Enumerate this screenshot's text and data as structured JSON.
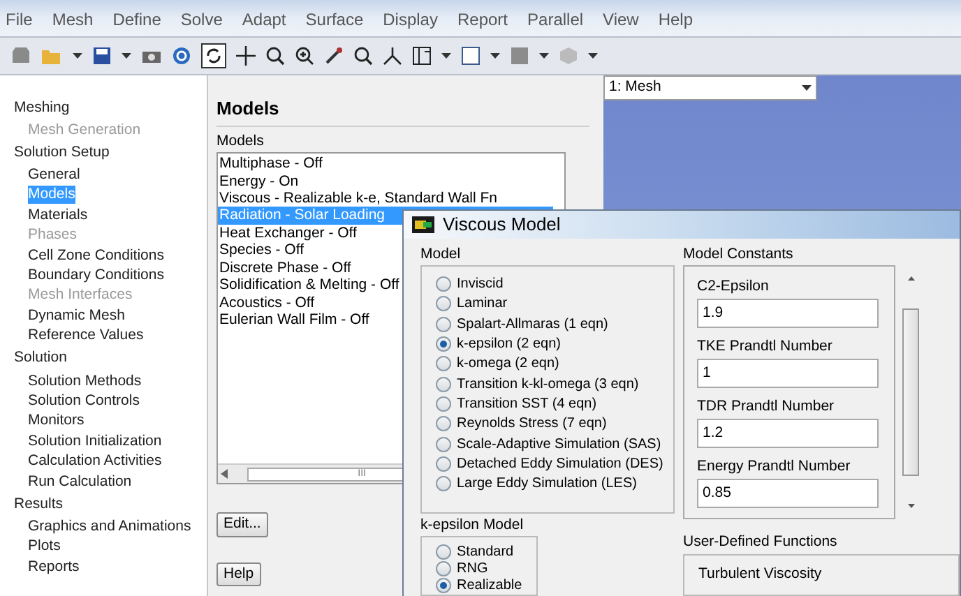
{
  "menu": [
    "File",
    "Mesh",
    "Define",
    "Solve",
    "Adapt",
    "Surface",
    "Display",
    "Report",
    "Parallel",
    "View",
    "Help"
  ],
  "sidebar": [
    {
      "label": "Meshing",
      "kind": "header",
      "selected": false,
      "disabled": false
    },
    {
      "label": "Mesh Generation",
      "kind": "item",
      "selected": false,
      "disabled": true
    },
    {
      "label": "Solution Setup",
      "kind": "header",
      "selected": false,
      "disabled": false
    },
    {
      "label": "General",
      "kind": "item",
      "selected": false,
      "disabled": false
    },
    {
      "label": "Models",
      "kind": "item",
      "selected": true,
      "disabled": false
    },
    {
      "label": "Materials",
      "kind": "item",
      "selected": false,
      "disabled": false
    },
    {
      "label": "Phases",
      "kind": "item",
      "selected": false,
      "disabled": true
    },
    {
      "label": "Cell Zone Conditions",
      "kind": "item",
      "selected": false,
      "disabled": false
    },
    {
      "label": "Boundary Conditions",
      "kind": "item",
      "selected": false,
      "disabled": false
    },
    {
      "label": "Mesh Interfaces",
      "kind": "item",
      "selected": false,
      "disabled": true
    },
    {
      "label": "Dynamic Mesh",
      "kind": "item",
      "selected": false,
      "disabled": false
    },
    {
      "label": "Reference Values",
      "kind": "item",
      "selected": false,
      "disabled": false
    },
    {
      "label": "Solution",
      "kind": "header",
      "selected": false,
      "disabled": false
    },
    {
      "label": "Solution Methods",
      "kind": "item",
      "selected": false,
      "disabled": false
    },
    {
      "label": "Solution Controls",
      "kind": "item",
      "selected": false,
      "disabled": false
    },
    {
      "label": "Monitors",
      "kind": "item",
      "selected": false,
      "disabled": false
    },
    {
      "label": "Solution Initialization",
      "kind": "item",
      "selected": false,
      "disabled": false
    },
    {
      "label": "Calculation Activities",
      "kind": "item",
      "selected": false,
      "disabled": false
    },
    {
      "label": "Run Calculation",
      "kind": "item",
      "selected": false,
      "disabled": false
    },
    {
      "label": "Results",
      "kind": "header",
      "selected": false,
      "disabled": false
    },
    {
      "label": "Graphics and Animations",
      "kind": "item",
      "selected": false,
      "disabled": false
    },
    {
      "label": "Plots",
      "kind": "item",
      "selected": false,
      "disabled": false
    },
    {
      "label": "Reports",
      "kind": "item",
      "selected": false,
      "disabled": false
    }
  ],
  "models_panel": {
    "title": "Models",
    "list_label": "Models",
    "models": [
      {
        "label": "Multiphase - Off",
        "selected": false
      },
      {
        "label": "Energy - On",
        "selected": false
      },
      {
        "label": "Viscous - Realizable k-e, Standard Wall Fn",
        "selected": false
      },
      {
        "label": "Radiation - Solar Loading",
        "selected": true
      },
      {
        "label": "Heat Exchanger - Off",
        "selected": false
      },
      {
        "label": "Species - Off",
        "selected": false
      },
      {
        "label": "Discrete Phase - Off",
        "selected": false
      },
      {
        "label": "Solidification & Melting - Off",
        "selected": false
      },
      {
        "label": "Acoustics - Off",
        "selected": false
      },
      {
        "label": "Eulerian Wall Film - Off",
        "selected": false
      }
    ],
    "scroll_mark": "III",
    "edit_button": "Edit...",
    "help_button": "Help"
  },
  "graphics": {
    "window_select": "1: Mesh"
  },
  "dialog": {
    "title": "Viscous Model",
    "model_label": "Model",
    "models": [
      {
        "label": "Inviscid",
        "selected": false
      },
      {
        "label": "Laminar",
        "selected": false
      },
      {
        "label": "Spalart-Allmaras (1 eqn)",
        "selected": false
      },
      {
        "label": "k-epsilon (2 eqn)",
        "selected": true
      },
      {
        "label": "k-omega (2 eqn)",
        "selected": false
      },
      {
        "label": "Transition k-kl-omega (3 eqn)",
        "selected": false
      },
      {
        "label": "Transition SST (4 eqn)",
        "selected": false
      },
      {
        "label": "Reynolds Stress (7 eqn)",
        "selected": false
      },
      {
        "label": "Scale-Adaptive Simulation (SAS)",
        "selected": false
      },
      {
        "label": "Detached Eddy Simulation (DES)",
        "selected": false
      },
      {
        "label": "Large Eddy Simulation (LES)",
        "selected": false
      }
    ],
    "k_epsilon_label": "k-epsilon Model",
    "k_epsilon_models": [
      {
        "label": "Standard",
        "selected": false
      },
      {
        "label": "RNG",
        "selected": false
      },
      {
        "label": "Realizable",
        "selected": true
      }
    ],
    "constants_label": "Model Constants",
    "constants": [
      {
        "label": "C2-Epsilon",
        "value": "1.9"
      },
      {
        "label": "TKE Prandtl Number",
        "value": "1"
      },
      {
        "label": "TDR Prandtl Number",
        "value": "1.2"
      },
      {
        "label": "Energy Prandtl Number",
        "value": "0.85"
      }
    ],
    "udf_label": "User-Defined Functions",
    "udf_field": "Turbulent Viscosity"
  }
}
